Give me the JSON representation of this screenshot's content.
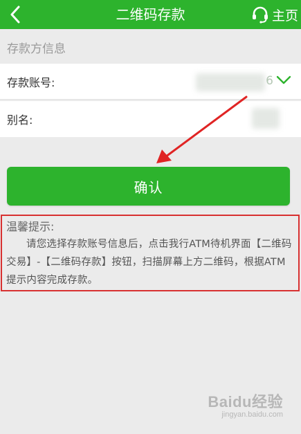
{
  "header": {
    "title": "二维码存款",
    "home_label": "主页"
  },
  "section": {
    "title": "存款方信息"
  },
  "form": {
    "account_label": "存款账号:",
    "account_suffix": "6",
    "name_label": "别名:"
  },
  "confirm_button": {
    "label": "确认"
  },
  "tips": {
    "title": "温馨提示:",
    "body": "请您选择存款账号信息后，点击我行ATM待机界面【二维码交易】-【二维码存款】按钮，扫描屏幕上方二维码，根据ATM提示内容完成存款。"
  },
  "watermark": {
    "logo": "Baidu经验",
    "sub": "jingyan.baidu.com"
  },
  "colors": {
    "brand_green": "#2db32d",
    "tip_border_red": "#d83030",
    "annotation_arrow": "#e02424"
  },
  "icons": {
    "back": "chevron-left-icon",
    "home": "headset-icon",
    "dropdown": "chevron-down-icon"
  }
}
